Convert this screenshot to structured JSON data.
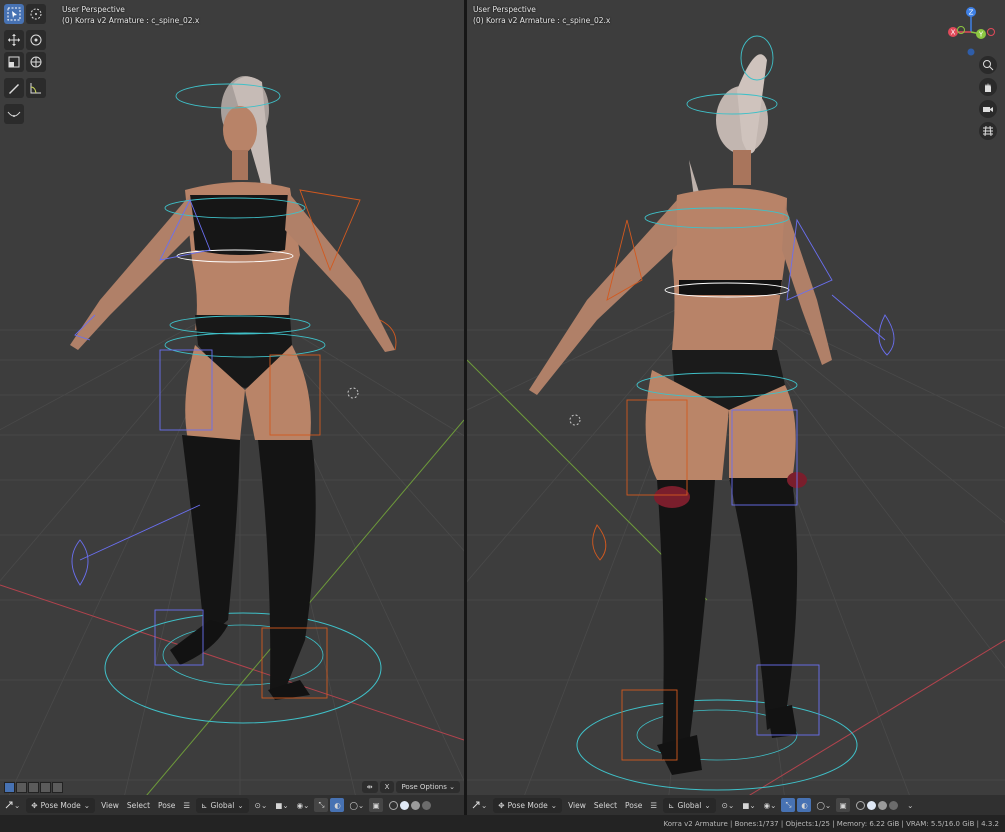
{
  "viewports": {
    "left": {
      "perspective": "User Perspective",
      "context": "(0) Korra v2 Armature : c_spine_02.x"
    },
    "right": {
      "perspective": "User Perspective",
      "context": "(0) Korra v2 Armature : c_spine_02.x"
    }
  },
  "header": {
    "mode": "Pose Mode",
    "menus": [
      "View",
      "Select",
      "Pose"
    ],
    "orientation": "Global"
  },
  "pose_options": {
    "x_label": "X",
    "label": "Pose Options"
  },
  "gizmo": {
    "z": "Z",
    "x": "X",
    "y": "Y"
  },
  "statusbar": {
    "text": "Korra v2 Armature | Bones:1/737 | Objects:1/25 | Memory: 6.22 GiB | VRAM: 5.5/16.0 GiB | 4.3.2"
  },
  "colors": {
    "viewport_bg": "#3d3d3d",
    "accent": "#4772b3",
    "axis_x": "#e04a5a",
    "axis_y": "#8cc641",
    "axis_z": "#3e80e6",
    "rig_cyan": "#3fc0c8",
    "rig_orange": "#d2591f",
    "rig_blue": "#6a6ff0",
    "skin": "#b88368",
    "hair": "#cfc3bd",
    "cloth": "#141414"
  },
  "icons": [
    "select-box-icon",
    "cursor-icon",
    "move-icon",
    "rotate-icon",
    "scale-icon",
    "transform-icon",
    "annotate-icon",
    "measure-icon",
    "relax-icon",
    "zoom-icon",
    "hand-icon",
    "camera-icon",
    "grid-icon"
  ]
}
